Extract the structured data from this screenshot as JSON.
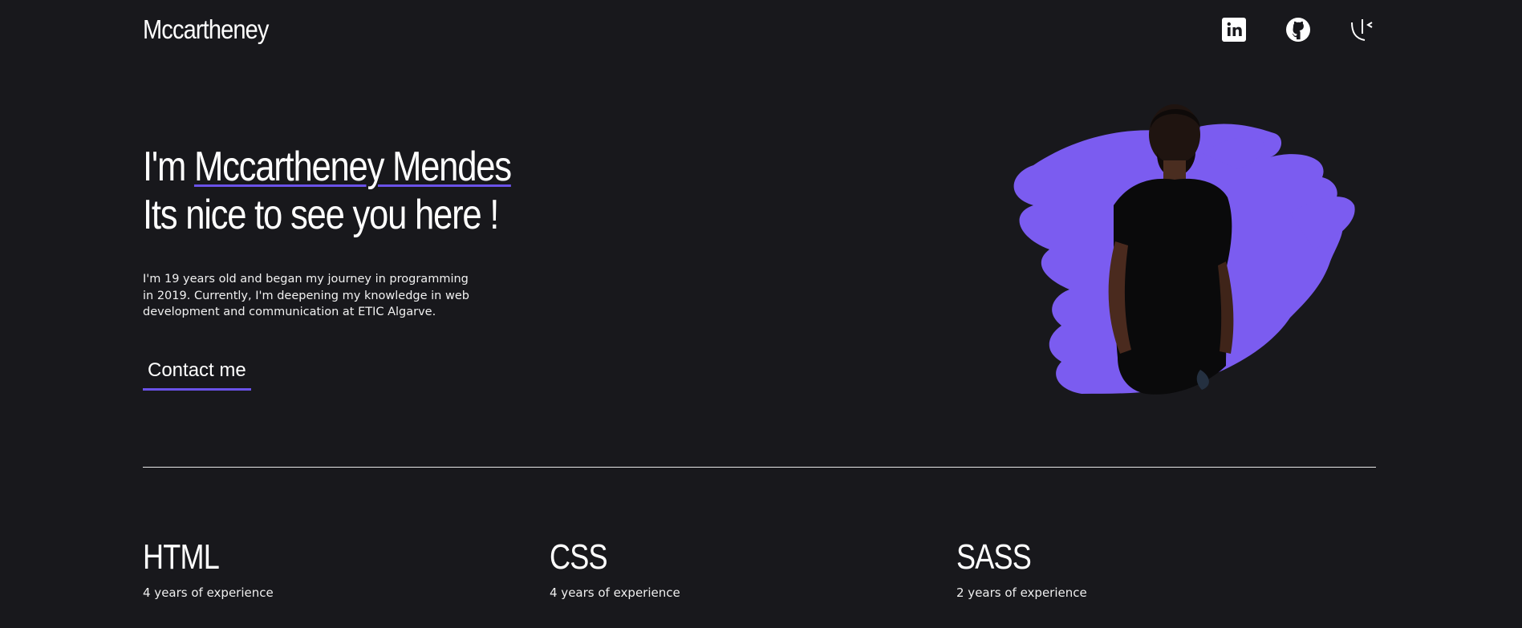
{
  "header": {
    "brand": "Mccartheney",
    "social": [
      {
        "name": "linkedin-icon"
      },
      {
        "name": "github-icon"
      },
      {
        "name": "custom-logo-icon"
      }
    ]
  },
  "hero": {
    "greeting_prefix": "I'm ",
    "name": "Mccartheney Mendes",
    "line2": "Its nice to see you here !",
    "intro": "I'm 19 years old and began my journey in programming in 2019. Currently, I'm deepening my knowledge in web development and communication at ETIC Algarve.",
    "contact_label": "Contact me"
  },
  "skills": [
    {
      "name": "HTML",
      "experience": "4 years of experience"
    },
    {
      "name": "CSS",
      "experience": "4 years of experience"
    },
    {
      "name": "SASS",
      "experience": "2 years of experience"
    }
  ],
  "colors": {
    "background": "#18181c",
    "accent": "#6a52e8",
    "blob": "#7b5cf0",
    "text": "#ffffff"
  }
}
